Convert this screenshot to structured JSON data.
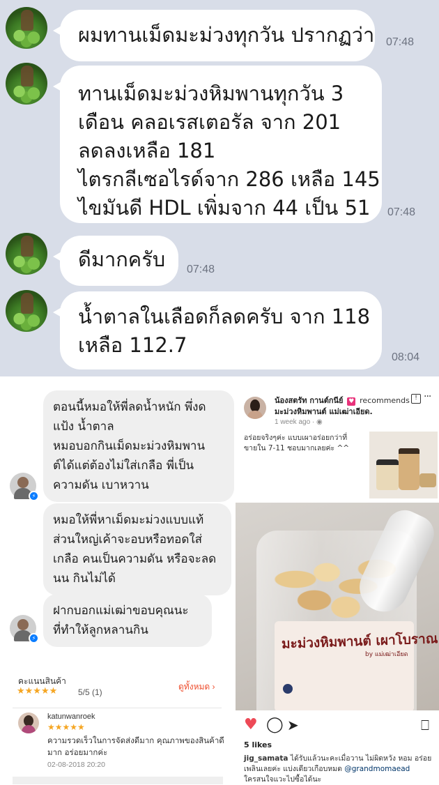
{
  "line_chat": {
    "messages": [
      {
        "lines": [
          "ผมทานเม็ดมะม่วงทุกวัน ปรากฏว่า"
        ],
        "time": "07:48"
      },
      {
        "lines": [
          "ทานเม็ดมะม่วงหิมพานทุกวัน 3",
          "เดือน คลอเรสเตอรัล จาก 201",
          "ลดลงเหลือ 181",
          "ไตรกลีเซอไรด์จาก 286 เหลือ 145",
          "ไขมันดี HDL เพิ่มจาก 44 เป็น 51"
        ],
        "time": "07:48"
      },
      {
        "lines": [
          "ดีมากครับ"
        ],
        "time": "07:48"
      },
      {
        "lines": [
          "น้ำตาลในเลือดก็ลดครับ จาก 118",
          "เหลือ 112.7"
        ],
        "time": "08:04"
      }
    ]
  },
  "messenger_chat": {
    "messages": [
      {
        "lines": [
          "ตอนนี้หมอให้พี่ลดน้ำหนัก พึ่งด",
          "แป้ง น้ำตาล",
          "หมอบอกกินเม็ดมะม่วงหิมพาน",
          "ต์ได้แต่ต้องไม่ใส่เกลือ พี่เป็น",
          "ความดัน เบาหวาน"
        ]
      },
      {
        "lines": [
          "หมอให้พี่หาเม็ดมะม่วงแบบแท้",
          "ส่วนใหญ่เค้าจะอบหรือทอดใส่",
          "เกลือ คนเป็นความดัน หรือจะลด",
          "นน กินไม่ได้"
        ]
      },
      {
        "lines": [
          "ฝากบอกแม่เฒ่าขอบคุณนะ",
          "ที่ทำให้ลูกหลานกิน"
        ]
      }
    ]
  },
  "review": {
    "section_label": "คะแนนสินค้า",
    "stars": "★★★★★",
    "score": "5/5 (1)",
    "view_all": "ดูทั้งหมด",
    "username": "katunwanroek",
    "user_stars": "★★★★★",
    "text_lines": [
      "ความรวดเร็วในการจัดส่งดีมาก คุณภาพของสินค้าดี",
      "มาก อร่อยมากค่ะ"
    ],
    "date": "02-08-2018 20:20"
  },
  "instagram": {
    "poster_name": "น้องสตรัท กานต์กนีย์",
    "recommends": "recommends",
    "page_name": "มะม่วงหิมพานต์ แม่เฒ่าเอียด.",
    "time": "1 week ago · ",
    "top_caption_lines": [
      "อร่อยจริงๆค่ะ แบบเผาอร่อยกว่าที่",
      "ขายใน 7-11 ชอบมากเลยค่ะ ^^"
    ],
    "photo_brand": "มะม่วงหิมพานต์ เผาโบราณ",
    "photo_by": "by แม่เฒ่าเอียด",
    "likes": "5 likes",
    "username": "jig_samata",
    "caption_line1": " ได้รับแล้วนะคะเมื่อวาน  ไม่ผิดหวัง  หอม อร่อย",
    "caption_line2_a": "เพลินเลยค่ะ แบ่งเดียวเกือบหมด ",
    "mention": "@grandmomaead",
    "caption_line3": "ใครสนใจแวะไปซื้อได้นะ"
  }
}
